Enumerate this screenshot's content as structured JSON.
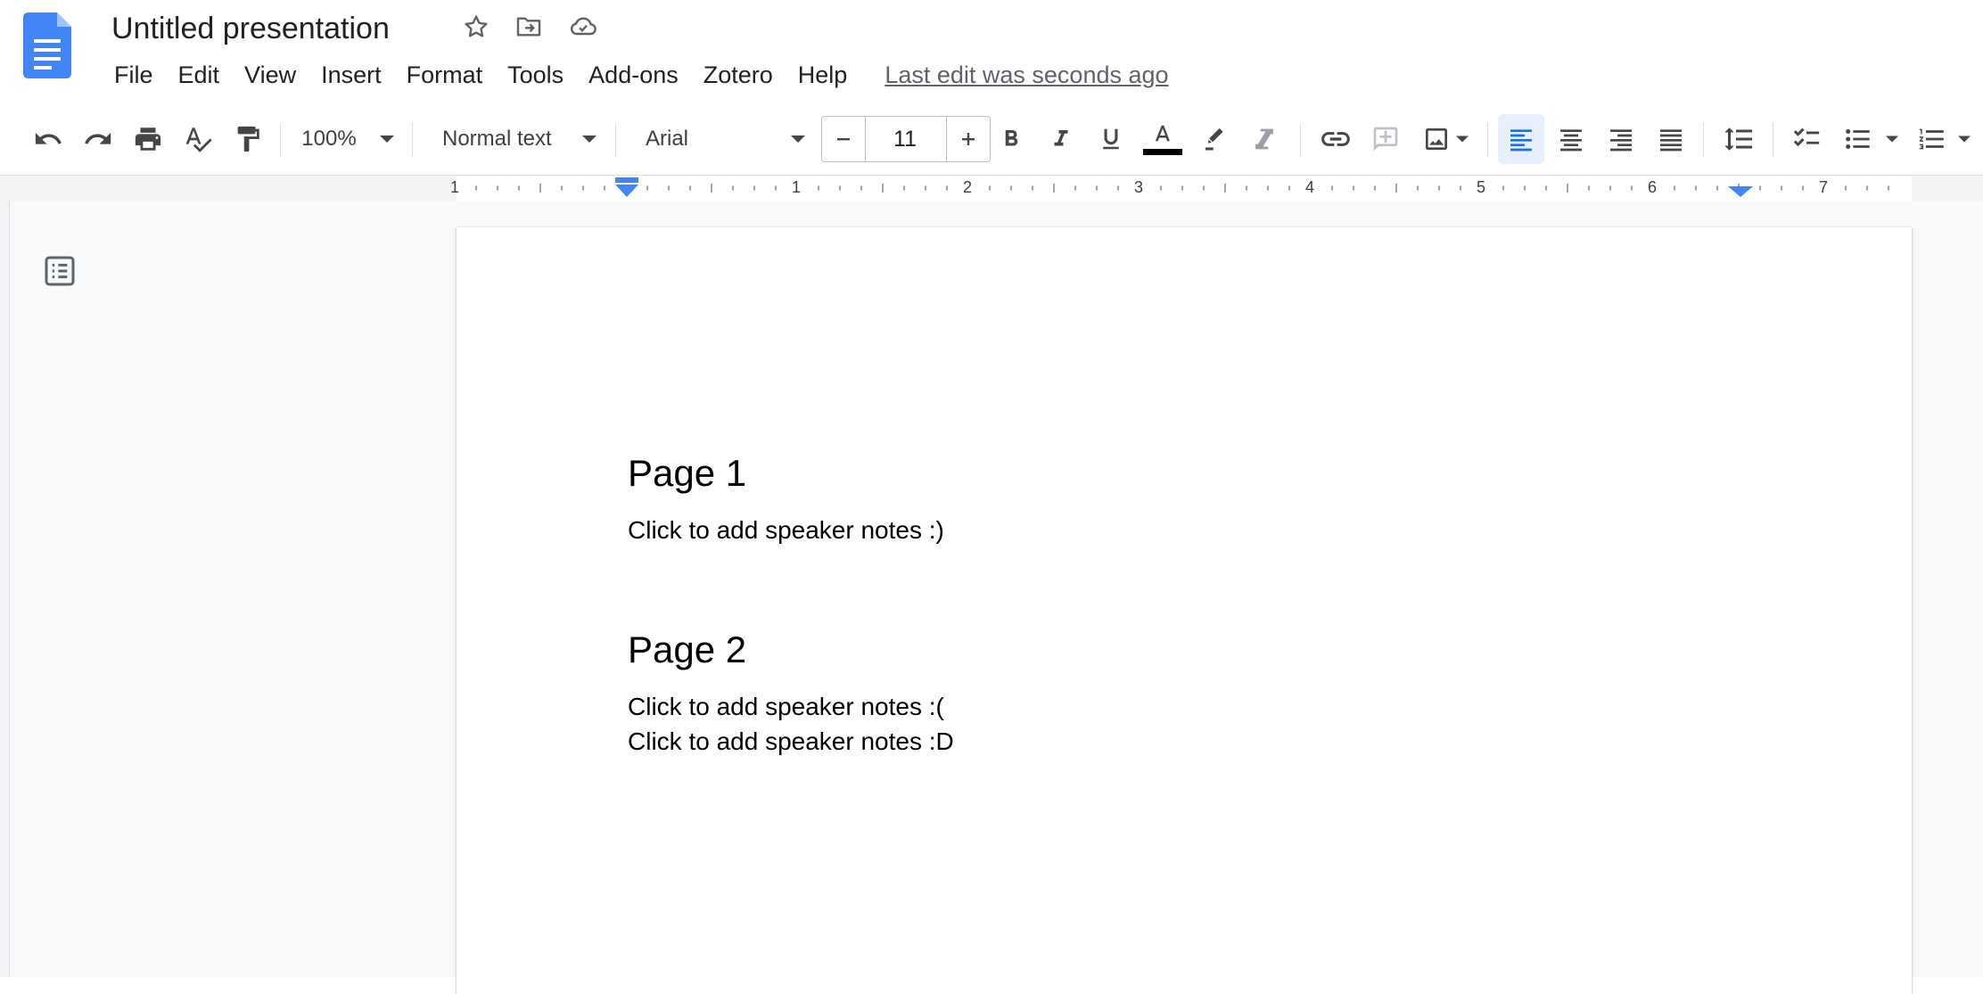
{
  "header": {
    "title": "Untitled presentation",
    "last_edit": "Last edit was seconds ago"
  },
  "menu": [
    "File",
    "Edit",
    "View",
    "Insert",
    "Format",
    "Tools",
    "Add-ons",
    "Zotero",
    "Help"
  ],
  "toolbar": {
    "zoom": "100%",
    "style": "Normal text",
    "font": "Arial",
    "font_size": "11",
    "accent_color": "#1a73e8"
  },
  "ruler": {
    "labels": [
      "1",
      "1",
      "2",
      "3",
      "4",
      "5",
      "6",
      "7"
    ]
  },
  "document": {
    "sections": [
      {
        "heading": "Page 1",
        "lines": [
          "Click to add speaker notes :)"
        ]
      },
      {
        "heading": "Page 2",
        "lines": [
          "Click to add speaker notes :(",
          "Click to add speaker notes :D"
        ]
      }
    ]
  }
}
